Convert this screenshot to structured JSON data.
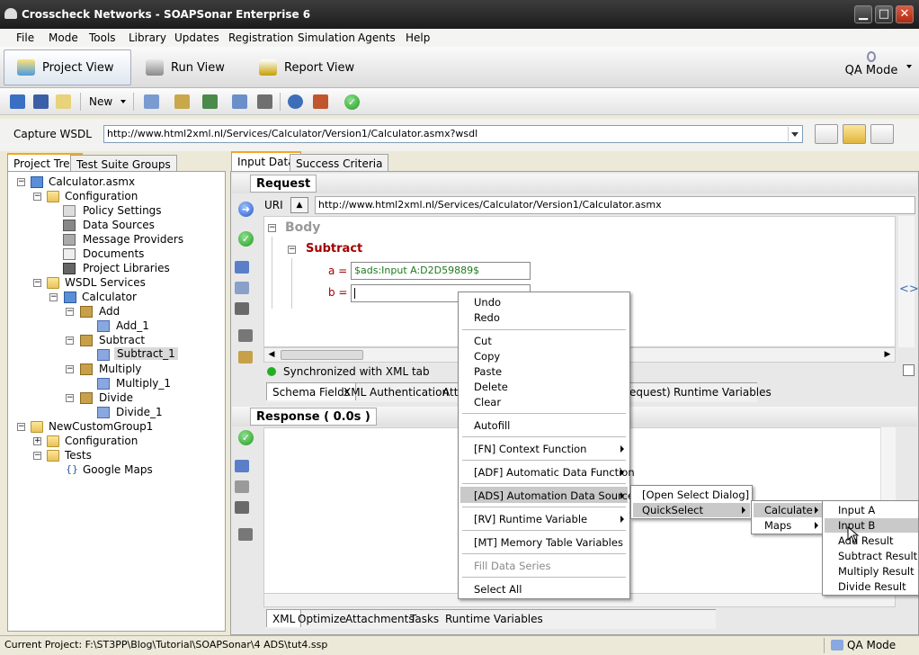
{
  "window": {
    "title": "Crosscheck Networks - SOAPSonar Enterprise 6",
    "min": "▁",
    "max": "□",
    "close": "✕"
  },
  "menu": [
    "File",
    "Mode",
    "Tools",
    "Library",
    "Updates",
    "Registration",
    "Simulation",
    "Agents",
    "Help"
  ],
  "views": {
    "project": "Project View",
    "run": "Run View",
    "report": "Report View",
    "qa": "QA Mode"
  },
  "toolbar": {
    "new_label": "New"
  },
  "wsdl": {
    "label": "Capture WSDL",
    "url": "http://www.html2xml.nl/Services/Calculator/Version1/Calculator.asmx?wsdl"
  },
  "left_tabs": [
    "Project Tree",
    "Test Suite Groups"
  ],
  "tree": [
    "Calculator.asmx",
    "Configuration",
    "Policy Settings",
    "Data Sources",
    "Message Providers",
    "Documents",
    "Project Libraries",
    "WSDL Services",
    "Calculator",
    "Add",
    "Add_1",
    "Subtract",
    "Subtract_1",
    "Multiply",
    "Multiply_1",
    "Divide",
    "Divide_1",
    "NewCustomGroup1",
    "Configuration",
    "Tests",
    "Google Maps"
  ],
  "right_tabs": [
    "Input Data",
    "Success Criteria"
  ],
  "request": {
    "header": "Request",
    "uri_label": "URI",
    "uri": "http://www.html2xml.nl/Services/Calculator/Version1/Calculator.asmx",
    "body": "Body",
    "operation": "Subtract",
    "a_label": "a =",
    "a_value": "$ads:Input A:D2D59889$",
    "b_label": "b =",
    "sync": "Synchronized with XML tab"
  },
  "req_tabs": [
    "Schema Fields",
    "XML",
    "Authentication",
    "Att",
    "equest)",
    "Runtime Variables"
  ],
  "response": {
    "header": "Response ( 0.0s )"
  },
  "resp_tabs": [
    "XML",
    "Optimize",
    "Attachments",
    "Tasks",
    "Runtime Variables"
  ],
  "context_menu": [
    "Undo",
    "Redo",
    "Cut",
    "Copy",
    "Paste",
    "Delete",
    "Clear",
    "Autofill",
    "[FN] Context Function",
    "[ADF] Automatic Data Function",
    "[ADS] Automation Data Source",
    "[RV] Runtime Variable",
    "[MT] Memory Table Variables",
    "Fill Data Series",
    "Select All"
  ],
  "ads_menu": [
    "[Open Select Dialog]",
    "QuickSelect"
  ],
  "quick_menu": [
    "Calculate",
    "Maps"
  ],
  "calc_menu": [
    "Input A",
    "Input B",
    "Add Result",
    "Subtract Result",
    "Multiply Result",
    "Divide Result"
  ],
  "status": {
    "project": "Current Project: F:\\ST3PP\\Blog\\Tutorial\\SOAPSonar\\4 ADS\\tut4.ssp",
    "mode": "QA Mode"
  },
  "colors": {
    "accent_orange": "#f5a623",
    "operation_red": "#a30000",
    "value_green": "#1c7a1c",
    "menu_highlight": "#c9c9c9"
  }
}
